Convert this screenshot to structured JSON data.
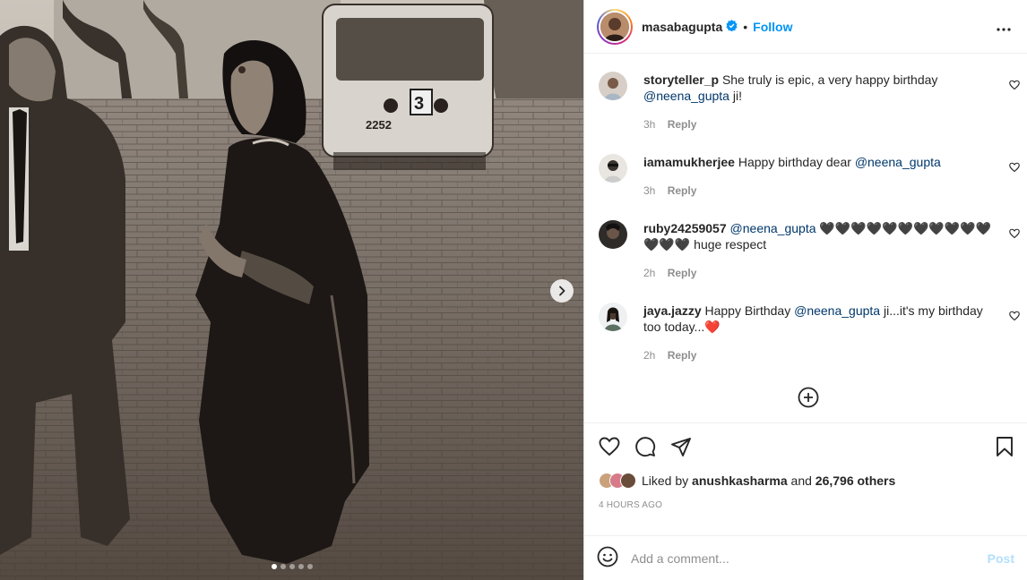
{
  "post": {
    "username": "masabagupta",
    "separator": "•",
    "follow_label": "Follow",
    "more_icon": "more-horizontal-icon",
    "carousel": {
      "total_slides": 5,
      "active_index": 0
    }
  },
  "comments": [
    {
      "username": "storyteller_p",
      "text_before": "She truly is epic, a very happy birthday",
      "mention": "@neena_gupta",
      "text_after": "ji!",
      "time": "3h",
      "reply_label": "Reply"
    },
    {
      "username": "iamamukherjee",
      "text_before": "Happy birthday dear",
      "mention": "@neena_gupta",
      "text_after": "",
      "time": "3h",
      "reply_label": "Reply"
    },
    {
      "username": "ruby24259057",
      "text_before": "",
      "mention": "@neena_gupta",
      "text_after": "🖤🖤🖤🖤🖤🖤🖤🖤🖤🖤🖤🖤🖤🖤 huge respect",
      "time": "2h",
      "reply_label": "Reply"
    },
    {
      "username": "jaya.jazzy",
      "text_before": "Happy Birthday",
      "mention": "@neena_gupta",
      "text_after": "ji...it's my birthday too today...❤️",
      "time": "2h",
      "reply_label": "Reply"
    }
  ],
  "likes": {
    "prefix": "Liked by",
    "user": "anushkasharma",
    "joiner": "and",
    "count": "26,796 others"
  },
  "timestamp": "4 HOURS AGO",
  "add_comment": {
    "placeholder": "Add a comment...",
    "post_label": "Post"
  },
  "colors": {
    "accent": "#0095f6",
    "mention": "#00376b",
    "muted": "#8e8e8e",
    "post_disabled": "#b2dffc"
  }
}
